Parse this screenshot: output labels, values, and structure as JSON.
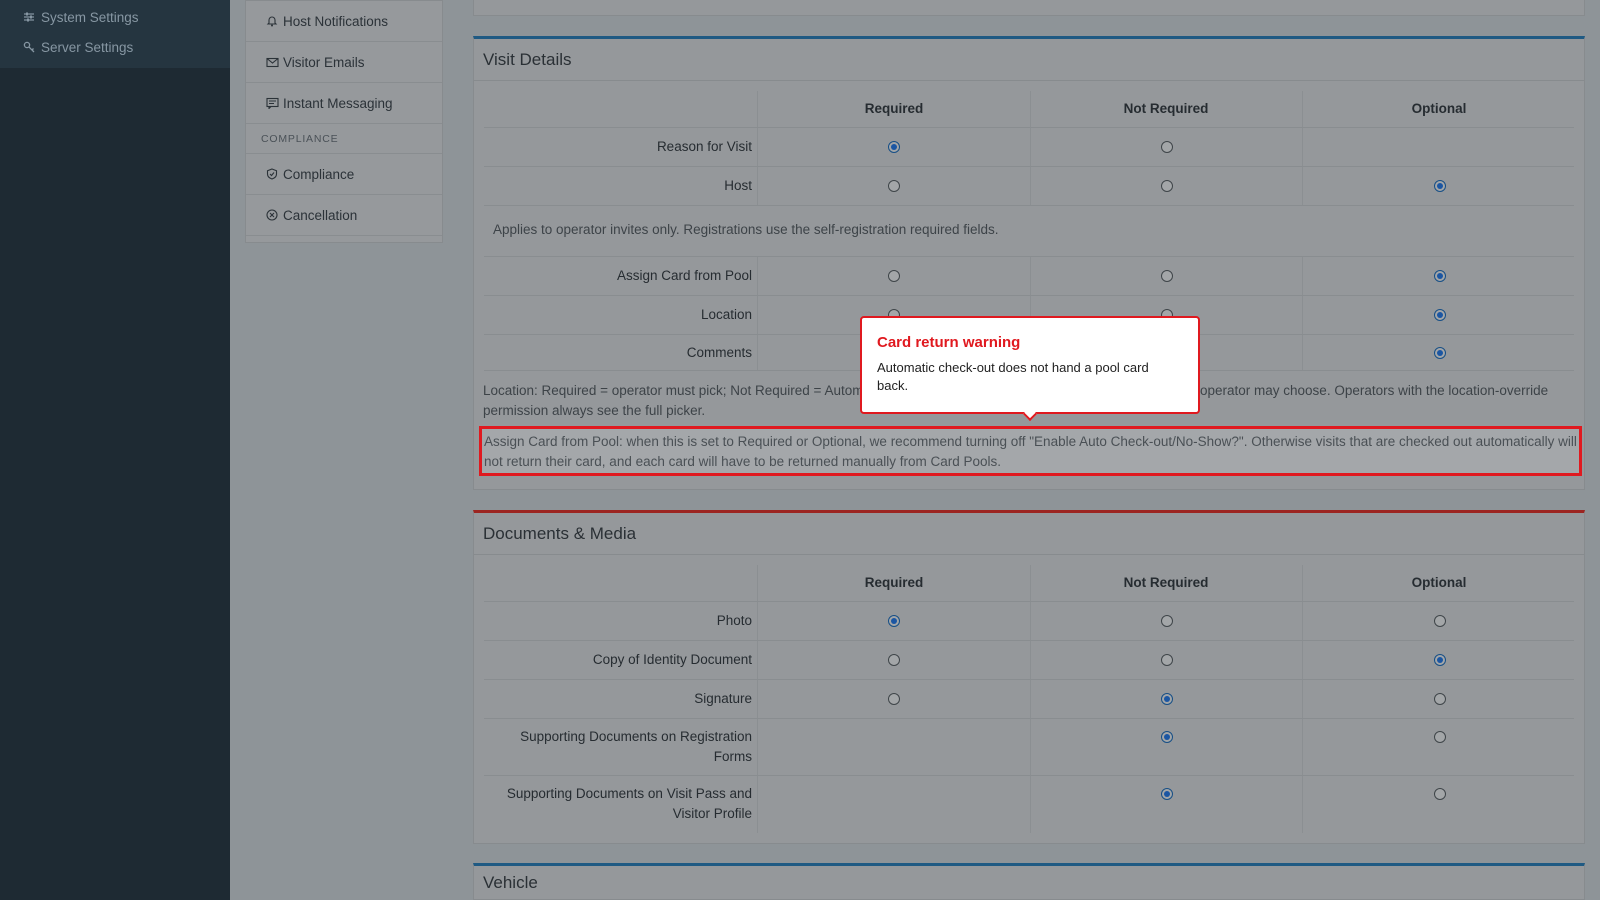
{
  "sidebar": {
    "items": [
      {
        "label": "System Settings",
        "icon": "sliders-icon"
      },
      {
        "label": "Server Settings",
        "icon": "key-icon"
      }
    ]
  },
  "submenu": {
    "items": [
      {
        "label": "Host Notifications",
        "icon": "bell-icon"
      },
      {
        "label": "Visitor Emails",
        "icon": "envelope-icon"
      },
      {
        "label": "Instant Messaging",
        "icon": "message-icon"
      }
    ],
    "section_heading": "COMPLIANCE",
    "section_items": [
      {
        "label": "Compliance",
        "icon": "shield-icon"
      },
      {
        "label": "Cancellation",
        "icon": "cancel-icon"
      }
    ]
  },
  "columns": {
    "required": "Required",
    "not_required": "Not Required",
    "optional": "Optional"
  },
  "visit_details": {
    "title": "Visit Details",
    "rows": [
      {
        "label": "Reason for Visit",
        "selected": "required",
        "options": [
          "required",
          "not_required"
        ]
      },
      {
        "label": "Host",
        "selected": "optional",
        "options": [
          "required",
          "not_required",
          "optional"
        ]
      },
      {
        "label": "Assign Card from Pool",
        "selected": "optional",
        "options": [
          "required",
          "not_required",
          "optional"
        ]
      },
      {
        "label": "Location",
        "selected": "optional",
        "options": [
          "required",
          "not_required",
          "optional"
        ]
      },
      {
        "label": "Comments",
        "selected": "optional",
        "options": [
          "required",
          "not_required",
          "optional"
        ]
      }
    ],
    "host_note": "Applies to operator invites only. Registrations use the self-registration required fields.",
    "location_note_left": "Location: Required = operator must pick; Not Required = Autom",
    "location_note_right": "operator may choose. Operators with the location-override",
    "location_note_line2": "permission always see the full picker.",
    "card_note": "Assign Card from Pool: when this is set to Required or Optional, we recommend turning off \"Enable Auto Check-out/No-Show?\". Otherwise visits that are checked out automatically will not return their card, and each card will have to be returned manually from Card Pools."
  },
  "popup": {
    "title": "Card return warning",
    "body": "Automatic check-out does not hand a pool card back."
  },
  "documents_media": {
    "title": "Documents & Media",
    "rows": [
      {
        "label": "Photo",
        "selected": "required",
        "options": [
          "required",
          "not_required",
          "optional"
        ]
      },
      {
        "label": "Copy of Identity Document",
        "selected": "optional",
        "options": [
          "required",
          "not_required",
          "optional"
        ]
      },
      {
        "label": "Signature",
        "selected": "not_required",
        "options": [
          "required",
          "not_required",
          "optional"
        ]
      },
      {
        "label_line1": "Supporting Documents on Registration",
        "label_line2": "Forms",
        "selected": "not_required",
        "options": [
          "not_required",
          "optional"
        ]
      },
      {
        "label_line1": "Supporting Documents on Visit Pass and",
        "label_line2": "Visitor Profile",
        "selected": "not_required",
        "options": [
          "not_required",
          "optional"
        ]
      }
    ]
  },
  "vehicle": {
    "title": "Vehicle"
  },
  "colors": {
    "accent_blue": "#1b56a3",
    "warning_red": "#e0191f",
    "section_red": "#9c2521"
  }
}
